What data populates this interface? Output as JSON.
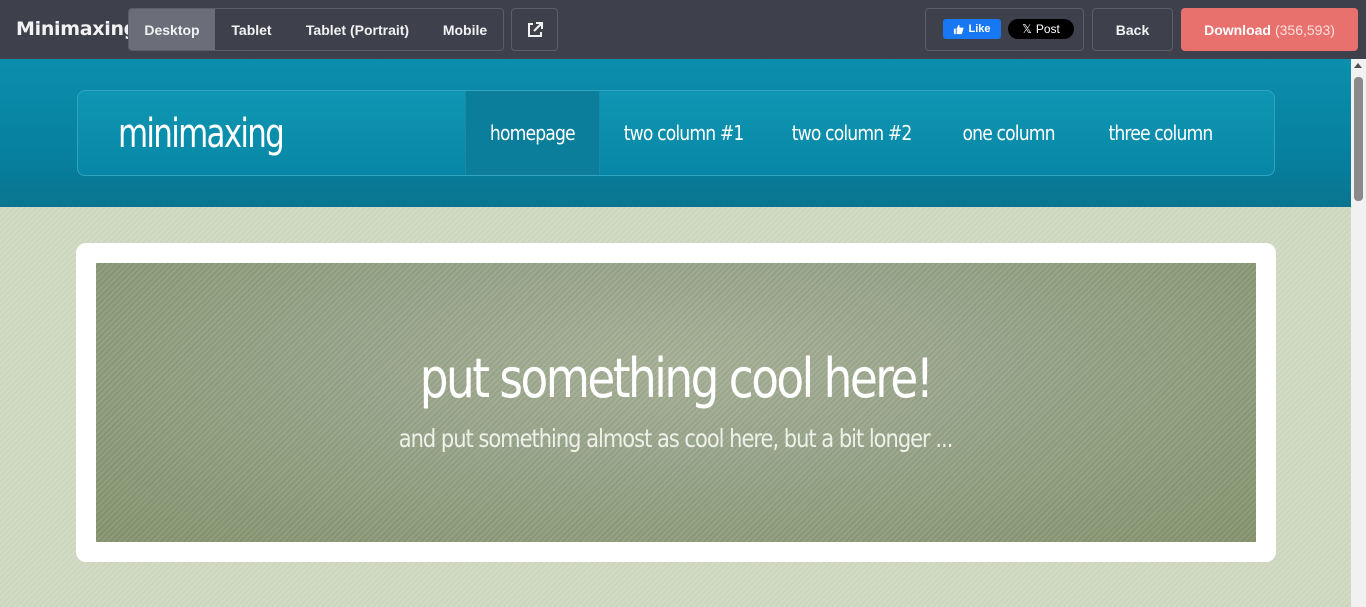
{
  "toolbar": {
    "brand": "Minimaxing",
    "devices": [
      {
        "label": "Desktop",
        "active": true
      },
      {
        "label": "Tablet",
        "active": false
      },
      {
        "label": "Tablet (Portrait)",
        "active": false
      },
      {
        "label": "Mobile",
        "active": false
      }
    ],
    "external_icon": "external-link-icon",
    "like_label": "Like",
    "post_label": "Post",
    "back_label": "Back",
    "download_label": "Download",
    "download_count": "(356,593)",
    "colors": {
      "bar": "#3e414c",
      "download": "#e8716e",
      "facebook": "#1877f2"
    }
  },
  "site": {
    "logo": "minimaxing",
    "nav": [
      {
        "label": "homepage",
        "active": true
      },
      {
        "label": "two column #1",
        "active": false
      },
      {
        "label": "two column #2",
        "active": false
      },
      {
        "label": "one column",
        "active": false
      },
      {
        "label": "three column",
        "active": false
      }
    ],
    "banner": {
      "title": "put something cool here!",
      "subtitle": "and put something almost as cool here, but a bit longer ..."
    },
    "colors": {
      "header": "#0787a6",
      "banner": "#98a58a",
      "page": "#d4dcc8"
    }
  }
}
